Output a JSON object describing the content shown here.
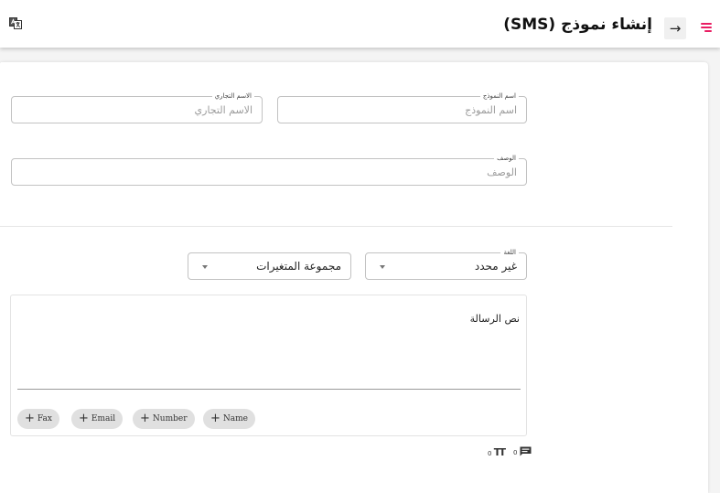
{
  "header": {
    "title": "إنشاء نموذج (SMS)",
    "back_glyph": "→"
  },
  "form": {
    "template_name": {
      "label": "اسم النموذج",
      "placeholder": "اسم النموذج"
    },
    "trade_name": {
      "label": "الاسم التجاري",
      "placeholder": "الاسم التجاري"
    },
    "description": {
      "label": "الوصف",
      "placeholder": "الوصف"
    },
    "language": {
      "label": "اللغة",
      "value": "غير محدد"
    },
    "variable_group": {
      "value": "مجموعة المتغيرات"
    }
  },
  "message": {
    "placeholder": "نص الرسالة",
    "chips": [
      {
        "label": "Name"
      },
      {
        "label": "Number"
      },
      {
        "label": "Email"
      },
      {
        "label": "Fax"
      }
    ],
    "plus_glyph": "+"
  },
  "counters": {
    "messages": "0",
    "characters": "0",
    "characters_glyph": "TT"
  },
  "colors": {
    "accent": "#e91e63"
  }
}
